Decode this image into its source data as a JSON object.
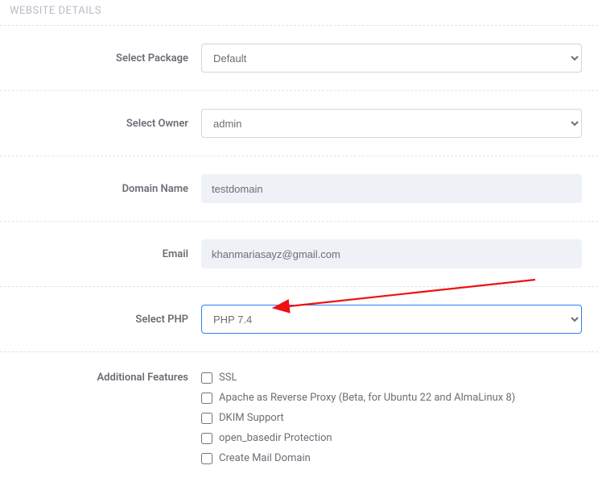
{
  "section_title": "WEBSITE DETAILS",
  "fields": {
    "package": {
      "label": "Select Package",
      "value": "Default"
    },
    "owner": {
      "label": "Select Owner",
      "value": "admin"
    },
    "domain": {
      "label": "Domain Name",
      "value": "testdomain"
    },
    "email": {
      "label": "Email",
      "value": "khanmariasayz@gmail.com"
    },
    "php": {
      "label": "Select PHP",
      "value": "PHP 7.4"
    },
    "features": {
      "label": "Additional Features",
      "items": [
        {
          "label": "SSL",
          "checked": false
        },
        {
          "label": "Apache as Reverse Proxy (Beta, for Ubuntu 22 and AlmaLinux 8)",
          "checked": false
        },
        {
          "label": "DKIM Support",
          "checked": false
        },
        {
          "label": "open_basedir Protection",
          "checked": false
        },
        {
          "label": "Create Mail Domain",
          "checked": false
        }
      ]
    }
  }
}
